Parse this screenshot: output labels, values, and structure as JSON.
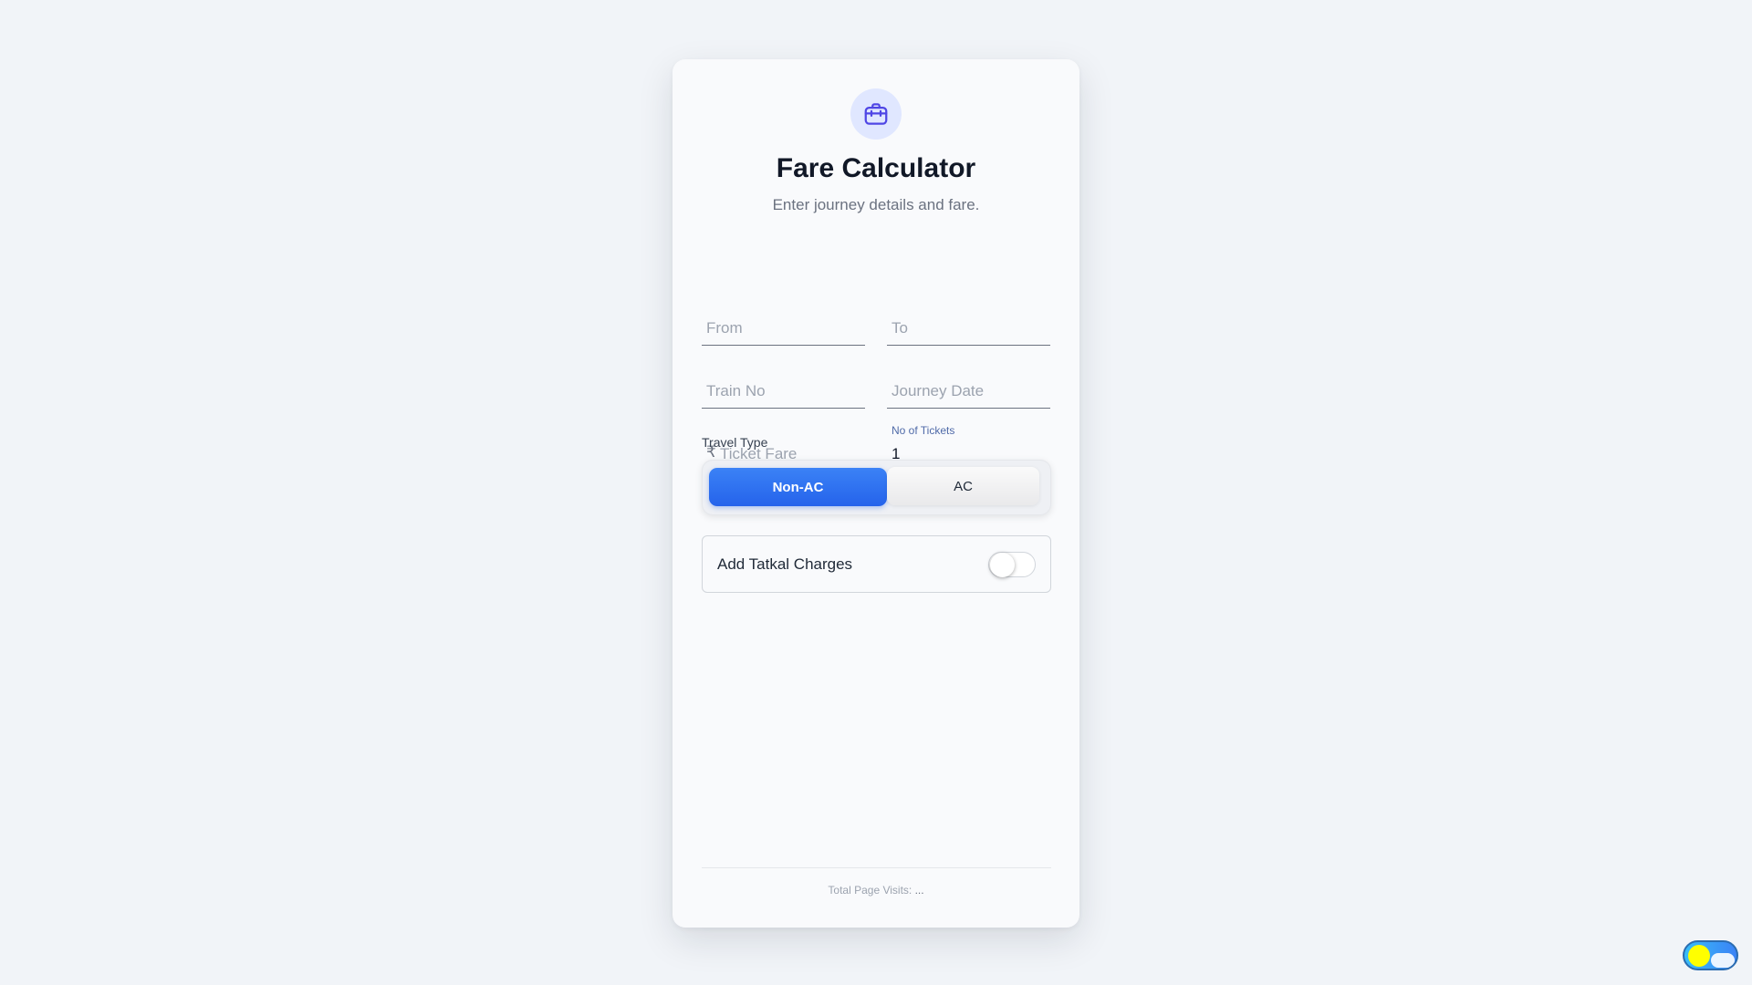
{
  "header": {
    "icon": "briefcase-icon",
    "title": "Fare Calculator",
    "subtitle": "Enter journey details and fare."
  },
  "form": {
    "from": {
      "placeholder": "From",
      "value": ""
    },
    "to": {
      "placeholder": "To",
      "value": ""
    },
    "train_no": {
      "placeholder": "Train No",
      "value": ""
    },
    "journey_date": {
      "placeholder": "Journey Date",
      "value": ""
    },
    "ticket_fare": {
      "currency_symbol": "₹",
      "placeholder": "Ticket Fare",
      "value": ""
    },
    "no_of_tickets": {
      "label": "No of Tickets",
      "value": "1"
    }
  },
  "travel_type": {
    "label": "Travel Type",
    "options": [
      "Non-AC",
      "AC"
    ],
    "selected": "Non-AC"
  },
  "tatkal": {
    "label": "Add Tatkal Charges",
    "enabled": false
  },
  "footer": {
    "visits_label": "Total Page Visits:",
    "visits_value": "..."
  },
  "theme_toggle": {
    "icon": "sun-cloud-icon",
    "mode": "light"
  },
  "colors": {
    "accent": "#2563eb",
    "background": "#f1f4f8",
    "card": "#f9fafc",
    "icon_bg": "#e0e7ff",
    "icon_fg": "#4f46e5",
    "sun": "#ffff00"
  }
}
